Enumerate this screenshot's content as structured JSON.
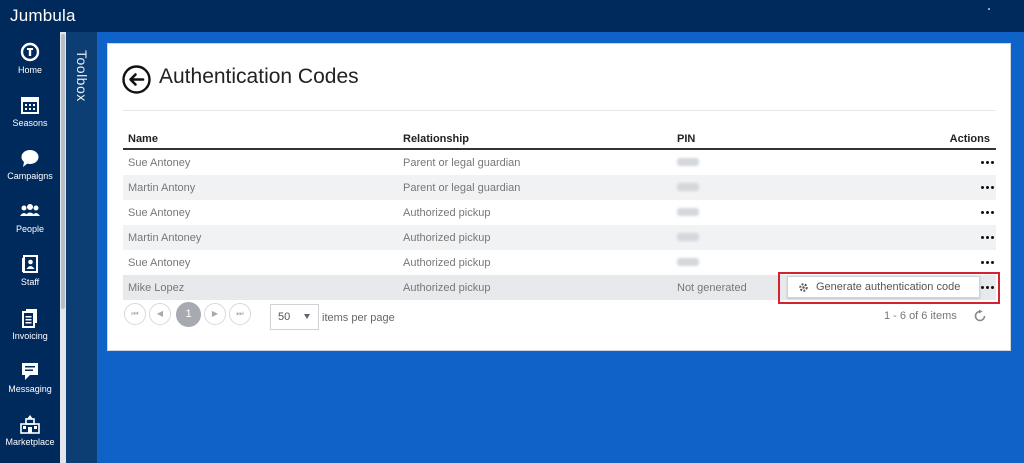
{
  "app": {
    "name": "Jumbula"
  },
  "sidebar": {
    "items": [
      {
        "label": "Home",
        "icon": "home-icon"
      },
      {
        "label": "Seasons",
        "icon": "calendar-icon"
      },
      {
        "label": "Campaigns",
        "icon": "chat-bubble-icon"
      },
      {
        "label": "People",
        "icon": "people-icon"
      },
      {
        "label": "Staff",
        "icon": "staff-badge-icon"
      },
      {
        "label": "Invoicing",
        "icon": "invoice-icon"
      },
      {
        "label": "Messaging",
        "icon": "message-icon"
      },
      {
        "label": "Marketplace",
        "icon": "marketplace-icon"
      }
    ]
  },
  "toolbox": {
    "label": "Toolbox"
  },
  "page": {
    "title": "Authentication Codes"
  },
  "table": {
    "columns": {
      "name": "Name",
      "relationship": "Relationship",
      "pin": "PIN",
      "actions": "Actions"
    },
    "rows": [
      {
        "name": "Sue Antoney",
        "relationship": "Parent or legal guardian",
        "pin": ""
      },
      {
        "name": "Martin Antony",
        "relationship": "Parent or legal guardian",
        "pin": ""
      },
      {
        "name": "Sue Antoney",
        "relationship": "Authorized pickup",
        "pin": ""
      },
      {
        "name": "Martin Antoney",
        "relationship": "Authorized pickup",
        "pin": ""
      },
      {
        "name": "Sue Antoney",
        "relationship": "Authorized pickup",
        "pin": ""
      },
      {
        "name": "Mike Lopez",
        "relationship": "Authorized pickup",
        "pin": "Not generated"
      }
    ]
  },
  "action_menu": {
    "generate_label": "Generate authentication code"
  },
  "pager": {
    "current_page": "1",
    "page_size": "50",
    "per_page_label": "items per page",
    "info": "1 - 6 of 6 items"
  },
  "colors": {
    "topbar": "#002a5c",
    "background": "#0f62c8",
    "highlight": "#d3232f"
  }
}
